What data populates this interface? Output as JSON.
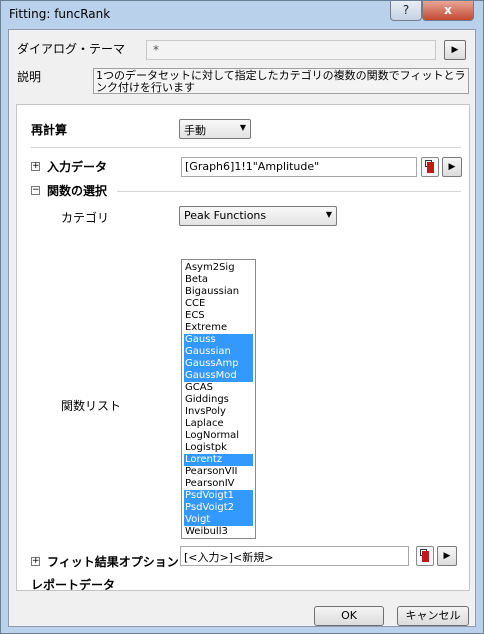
{
  "window": {
    "title": "Fitting: funcRank",
    "help_label": "?",
    "close_label": "x"
  },
  "theme": {
    "label": "ダイアログ・テーマ",
    "value": "*",
    "menu_label": "▶"
  },
  "description": {
    "label": "説明",
    "text": "1つのデータセットに対して指定したカテゴリの複数の関数でフィットとランク付けを行います"
  },
  "recalc": {
    "label": "再計算",
    "value": "手動"
  },
  "input": {
    "expander": "+",
    "label": "入力データ",
    "value": "[Graph6]1!1\"Amplitude\""
  },
  "function_select": {
    "expander": "−",
    "label": "関数の選択",
    "category_label": "カテゴリ",
    "category_value": "Peak Functions",
    "list_label": "関数リスト",
    "items": [
      {
        "label": "Asym2Sig",
        "selected": false
      },
      {
        "label": "Beta",
        "selected": false
      },
      {
        "label": "Bigaussian",
        "selected": false
      },
      {
        "label": "CCE",
        "selected": false
      },
      {
        "label": "ECS",
        "selected": false
      },
      {
        "label": "Extreme",
        "selected": false
      },
      {
        "label": "Gauss",
        "selected": true
      },
      {
        "label": "Gaussian",
        "selected": true
      },
      {
        "label": "GaussAmp",
        "selected": true
      },
      {
        "label": "GaussMod",
        "selected": true
      },
      {
        "label": "GCAS",
        "selected": false
      },
      {
        "label": "Giddings",
        "selected": false
      },
      {
        "label": "InvsPoly",
        "selected": false
      },
      {
        "label": "Laplace",
        "selected": false
      },
      {
        "label": "LogNormal",
        "selected": false
      },
      {
        "label": "Logistpk",
        "selected": false
      },
      {
        "label": "Lorentz",
        "selected": true
      },
      {
        "label": "PearsonVII",
        "selected": false
      },
      {
        "label": "PearsonIV",
        "selected": false
      },
      {
        "label": "PsdVoigt1",
        "selected": true
      },
      {
        "label": "PsdVoigt2",
        "selected": true
      },
      {
        "label": "Voigt",
        "selected": true
      },
      {
        "label": "Weibull3",
        "selected": false
      }
    ]
  },
  "fit_options": {
    "expander": "+",
    "label": "フィット結果オプション"
  },
  "report": {
    "label": "レポートデータ",
    "value": "[<入力>]<新規>"
  },
  "buttons": {
    "ok": "OK",
    "cancel": "キャンセル"
  },
  "colors": {
    "selection": "#3399ff",
    "title_bar": "#b9d1ea",
    "close_button": "#c24a34"
  }
}
